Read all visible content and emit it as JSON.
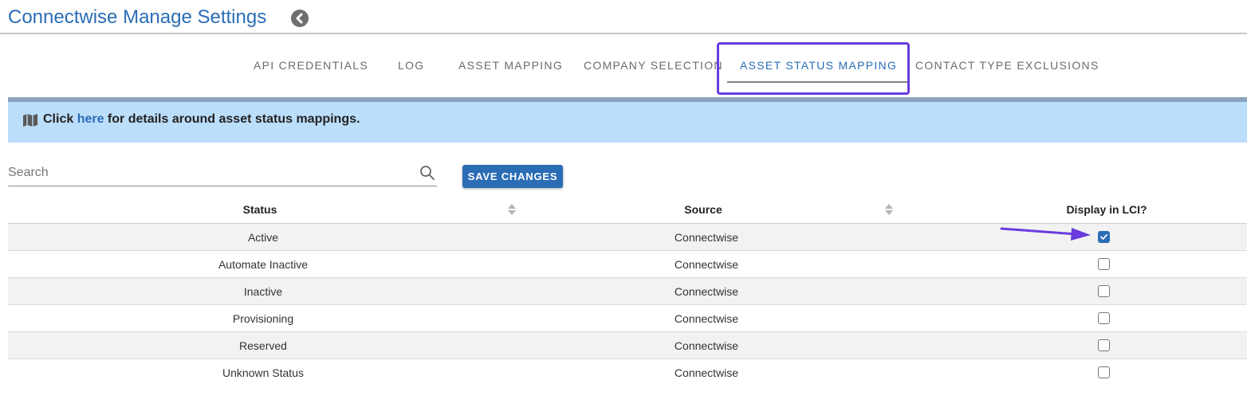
{
  "header": {
    "title": "Connectwise Manage Settings",
    "back_icon": "chevron-left-circle-icon"
  },
  "tabs": [
    {
      "label": "API CREDENTIALS",
      "active": false
    },
    {
      "label": "LOG",
      "active": false
    },
    {
      "label": "ASSET MAPPING",
      "active": false
    },
    {
      "label": "COMPANY SELECTION",
      "active": false
    },
    {
      "label": "ASSET STATUS MAPPING",
      "active": true
    },
    {
      "label": "CONTACT TYPE EXCLUSIONS",
      "active": false
    }
  ],
  "info": {
    "icon": "map-icon",
    "prefix": "Click ",
    "link": "here",
    "suffix": " for details around asset status mappings."
  },
  "search": {
    "placeholder": "Search",
    "value": ""
  },
  "toolbar": {
    "save_label": "SAVE CHANGES"
  },
  "table": {
    "columns": [
      "Status",
      "Source",
      "Display in LCI?"
    ],
    "rows": [
      {
        "status": "Active",
        "source": "Connectwise",
        "display": true
      },
      {
        "status": "Automate Inactive",
        "source": "Connectwise",
        "display": false
      },
      {
        "status": "Inactive",
        "source": "Connectwise",
        "display": false
      },
      {
        "status": "Provisioning",
        "source": "Connectwise",
        "display": false
      },
      {
        "status": "Reserved",
        "source": "Connectwise",
        "display": false
      },
      {
        "status": "Unknown Status",
        "source": "Connectwise",
        "display": false
      }
    ]
  },
  "colors": {
    "accent": "#2a6db5",
    "highlight": "#6a3bdd",
    "banner": "#bbdefb"
  }
}
